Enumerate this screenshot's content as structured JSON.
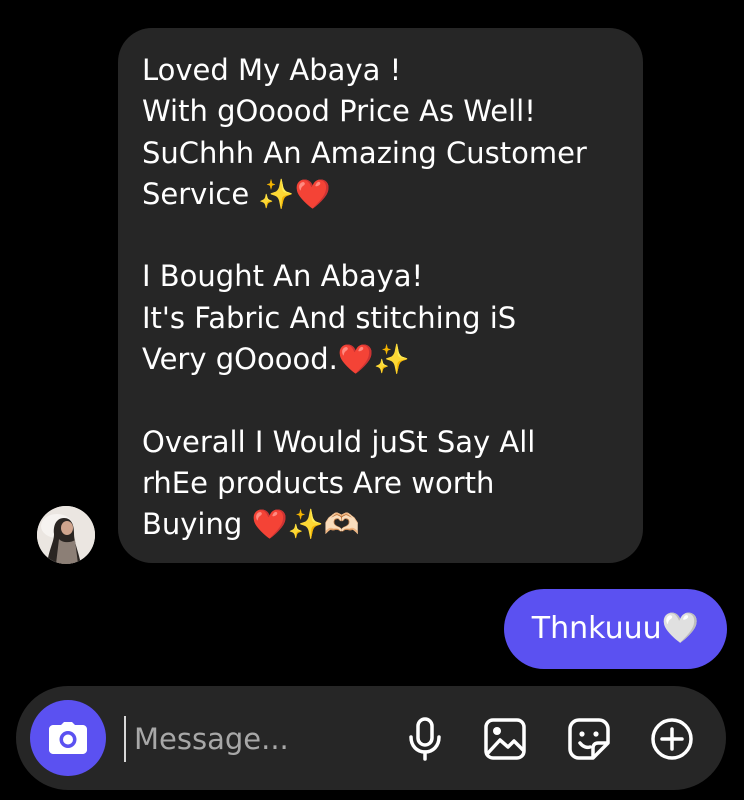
{
  "conversation": {
    "incoming_message": {
      "lines": [
        "Loved My Abaya !",
        "With gOoood Price As Well!",
        "SuChhh An Amazing Customer",
        "Service ✨❤️",
        "",
        "I Bought An Abaya!",
        "It's Fabric And stitching iS",
        "Very gOoood.❤️✨",
        "",
        "Overall I Would juSt Say All",
        "rhEe products Are worth",
        "Buying ❤️✨🫶🏻"
      ]
    },
    "outgoing_message": {
      "text": "Thnkuuu🤍"
    }
  },
  "composer": {
    "placeholder": "Message...",
    "icons": {
      "camera": "camera-icon",
      "microphone": "microphone-icon",
      "gallery": "gallery-icon",
      "sticker": "sticker-icon",
      "add": "add-icon"
    }
  },
  "colors": {
    "background": "#000000",
    "incoming_bubble": "#262626",
    "outgoing_bubble": "#5b51f1",
    "accent": "#5b51f1",
    "text": "#ffffff",
    "placeholder": "#a8a8a8"
  }
}
